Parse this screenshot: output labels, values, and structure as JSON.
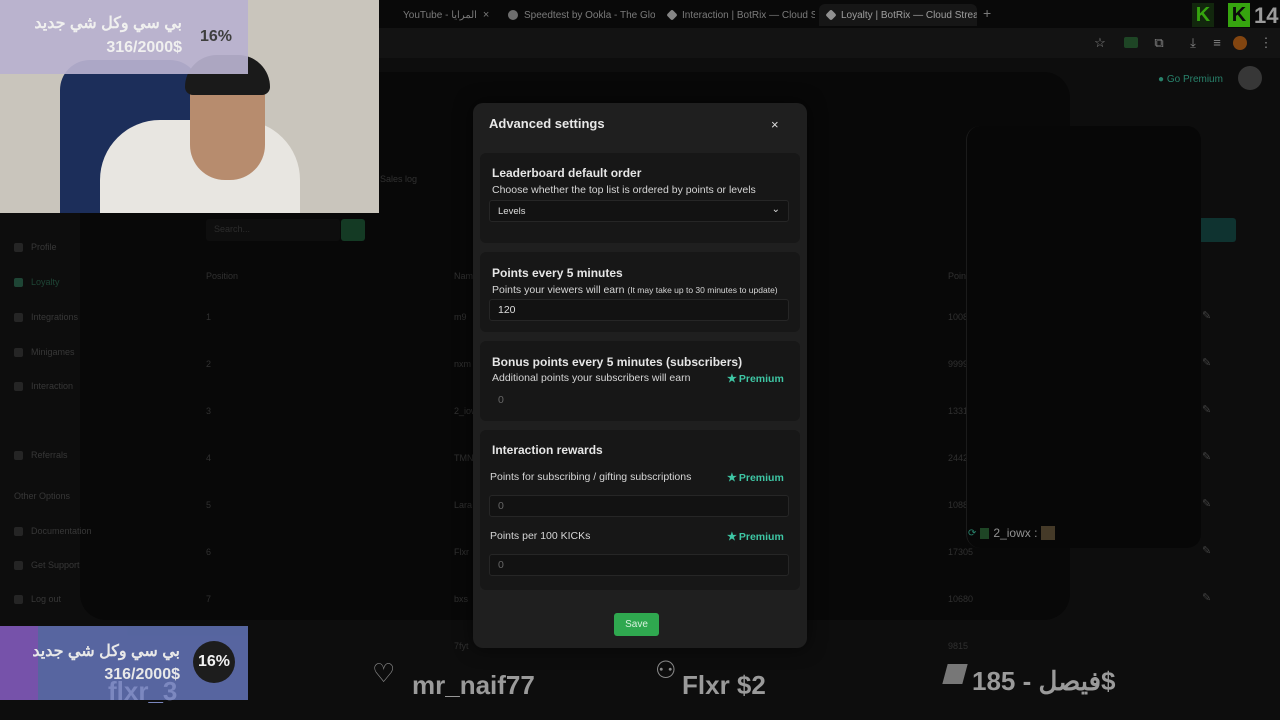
{
  "browser": {
    "tabs": [
      {
        "label": "YouTube - المرايا"
      },
      {
        "label": "Speedtest by Ookla - The Global"
      },
      {
        "label": "Interaction | BotRix — Cloud St"
      },
      {
        "label": "Loyalty | BotRix — Cloud Stream"
      }
    ],
    "new_tab": "+"
  },
  "site": {
    "sidebar": [
      {
        "label": "Profile"
      },
      {
        "label": "Loyalty"
      },
      {
        "label": "Integrations"
      },
      {
        "label": "Minigames"
      },
      {
        "label": "Interaction"
      },
      {
        "label": "Referrals"
      },
      {
        "label": "Other Options"
      },
      {
        "label": "Documentation"
      },
      {
        "label": "Get Support"
      },
      {
        "label": "Log out"
      }
    ],
    "tab_label": "Sales log",
    "search_placeholder": "Search...",
    "columns": {
      "position": "Position",
      "name": "Name",
      "points": "Points"
    },
    "rows": [
      {
        "pos": "1",
        "name": "m9",
        "points": "10082999"
      },
      {
        "pos": "2",
        "name": "nxm",
        "points": "9999999"
      },
      {
        "pos": "3",
        "name": "2_iowx",
        "points": "13315"
      },
      {
        "pos": "4",
        "name": "TMN",
        "points": "24425"
      },
      {
        "pos": "5",
        "name": "Lara",
        "points": "10880"
      },
      {
        "pos": "6",
        "name": "Flxr",
        "points": "17305"
      },
      {
        "pos": "7",
        "name": "bxs",
        "points": "10680"
      },
      {
        "pos": "8",
        "name": "7fyt",
        "points": "9815"
      }
    ],
    "status": "Go Premium",
    "chat_message": "2_iowx :"
  },
  "modal": {
    "title": "Advanced settings",
    "close": "×",
    "leaderboard": {
      "title": "Leaderboard default order",
      "desc": "Choose whether the top list is ordered by points or levels",
      "value": "Levels"
    },
    "points5": {
      "title": "Points every 5 minutes",
      "desc": "Points your viewers will earn",
      "note": "(It may take up to 30 minutes to update)",
      "value": "120"
    },
    "bonus": {
      "title": "Bonus points every 5 minutes (subscribers)",
      "desc": "Additional points your subscribers will earn",
      "premium": "Premium",
      "value": "0"
    },
    "interaction": {
      "title": "Interaction rewards",
      "subs_label": "Points for subscribing / gifting subscriptions",
      "subs_premium": "Premium",
      "subs_value": "0",
      "kicks_label": "Points per 100 KICKs",
      "kicks_premium": "Premium",
      "kicks_value": "0"
    },
    "save": "Save"
  },
  "stream": {
    "goal_top": {
      "title": "بي سي وكل شي جديد",
      "amount": "316/2000$",
      "percent": "16%"
    },
    "goal_bottom": {
      "title": "بي سي وكل شي جديد",
      "amount": "316/2000$",
      "percent": "16%"
    },
    "bottom_names": [
      "flxr_3",
      "mr_naif77",
      "Flxr $2",
      "فيصل - 185$"
    ],
    "logo_text": "14"
  },
  "colors": {
    "accent": "#3ec6a4",
    "save": "#2fa84f",
    "modal_bg": "#1f1f1f",
    "goal_bg": "#b9b2d0"
  }
}
